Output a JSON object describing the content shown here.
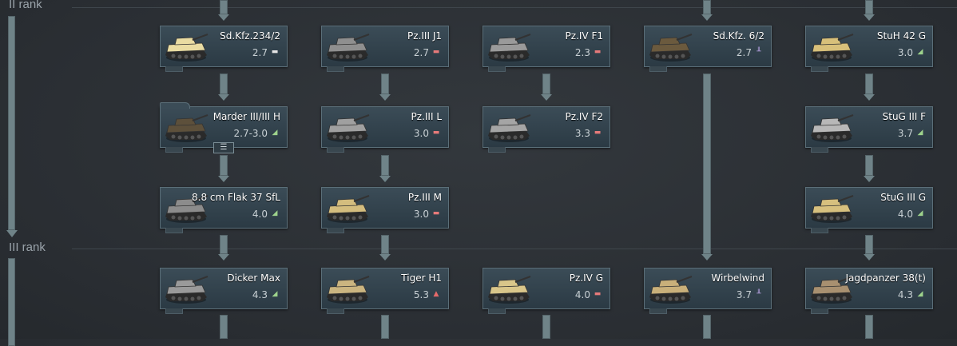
{
  "ranks": [
    {
      "label": "II rank"
    },
    {
      "label": "III rank"
    }
  ],
  "vehicles": [
    {
      "name": "Sd.Kfz.234/2",
      "br": "2.7",
      "role_icon": "light-tank-icon",
      "role_glyph": "▬",
      "color": "#e9dca2"
    },
    {
      "name": "Pz.III J1",
      "br": "2.7",
      "role_icon": "medium-tank-icon",
      "role_glyph": "▬",
      "color": "#8f8f8f"
    },
    {
      "name": "Pz.IV F1",
      "br": "2.3",
      "role_icon": "medium-tank-icon",
      "role_glyph": "▬",
      "color": "#9a9a9a"
    },
    {
      "name": "Sd.Kfz. 6/2",
      "br": "2.7",
      "role_icon": "spaa-icon",
      "role_glyph": "╨",
      "color": "#6b5a3e"
    },
    {
      "name": "StuH 42 G",
      "br": "3.0",
      "role_icon": "tank-destroyer-icon",
      "role_glyph": "◢",
      "color": "#d8c07a"
    },
    {
      "name": "Marder III/III H",
      "br": "2.7-3.0",
      "role_icon": "tank-destroyer-icon",
      "role_glyph": "◢",
      "color": "#5d503b"
    },
    {
      "name": "Pz.III L",
      "br": "3.0",
      "role_icon": "medium-tank-icon",
      "role_glyph": "▬",
      "color": "#a0a0a0"
    },
    {
      "name": "Pz.IV F2",
      "br": "3.3",
      "role_icon": "medium-tank-icon",
      "role_glyph": "▬",
      "color": "#a5a5a5"
    },
    {
      "name": "StuG III F",
      "br": "3.7",
      "role_icon": "tank-destroyer-icon",
      "role_glyph": "◢",
      "color": "#b8b8b8"
    },
    {
      "name": "8.8 cm Flak 37 SfL",
      "br": "4.0",
      "role_icon": "tank-destroyer-icon",
      "role_glyph": "◢",
      "color": "#8c8c8c"
    },
    {
      "name": "Pz.III M",
      "br": "3.0",
      "role_icon": "medium-tank-icon",
      "role_glyph": "▬",
      "color": "#d4bd7e"
    },
    {
      "name": "StuG III G",
      "br": "4.0",
      "role_icon": "tank-destroyer-icon",
      "role_glyph": "◢",
      "color": "#d7c07e"
    },
    {
      "name": "Dicker Max",
      "br": "4.3",
      "role_icon": "tank-destroyer-icon",
      "role_glyph": "◢",
      "color": "#9a9a9a"
    },
    {
      "name": "Tiger H1",
      "br": "5.3",
      "role_icon": "heavy-tank-icon",
      "role_glyph": "▲",
      "color": "#cbb580"
    },
    {
      "name": "Pz.IV G",
      "br": "4.0",
      "role_icon": "medium-tank-icon",
      "role_glyph": "▬",
      "color": "#d9c68a"
    },
    {
      "name": "Wirbelwind",
      "br": "3.7",
      "role_icon": "spaa-icon",
      "role_glyph": "╨",
      "color": "#c9b07a"
    },
    {
      "name": "Jagdpanzer 38(t)",
      "br": "4.3",
      "role_icon": "tank-destroyer-icon",
      "role_glyph": "◢",
      "color": "#a89070"
    }
  ],
  "group_badge": "☰"
}
